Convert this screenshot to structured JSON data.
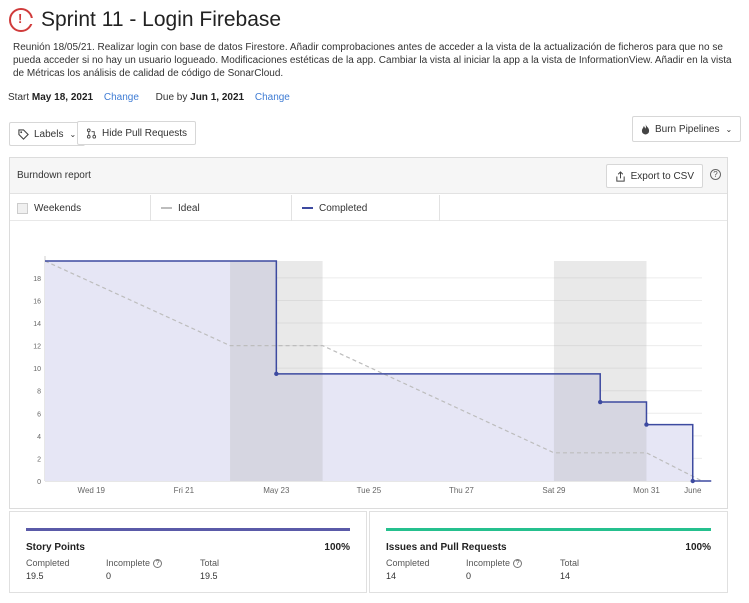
{
  "title": "Sprint 11 - Login Firebase",
  "description": "Reunión 18/05/21. Realizar login con base de datos Firestore. Añadir comprobaciones antes de acceder a la vista de la actualización de ficheros para que no se pueda acceder si no hay un usuario logueado. Modificaciones estéticas de la app. Cambiar la vista al iniciar la app a la vista de InformationView. Añadir en la vista de Métricas los análisis de calidad de código de SonarCloud.",
  "dates": {
    "start_label": "Start",
    "start_value": "May 18, 2021",
    "due_label": "Due by",
    "due_value": "Jun 1, 2021",
    "change_label": "Change"
  },
  "toolbar": {
    "labels_button": "Labels",
    "hide_pr_button": "Hide Pull Requests",
    "burn_pipelines_button": "Burn Pipelines"
  },
  "report": {
    "title": "Burndown report",
    "export_button": "Export to CSV",
    "legend": {
      "weekends": "Weekends",
      "ideal": "Ideal",
      "completed": "Completed"
    }
  },
  "colors": {
    "accent": "#3d4aa0",
    "ideal": "#bdbdbd",
    "weekend": "#e8e8e8",
    "completed_fill": "#e6e6f5",
    "danger": "#d03b3b",
    "issues_bar": "#25c08e",
    "story_bar": "#5a5aa8",
    "link": "#3f7cd4"
  },
  "chart_data": {
    "type": "line",
    "x_ticks": [
      "Wed 19",
      "Fri 21",
      "May 23",
      "Tue 25",
      "Thu 27",
      "Sat 29",
      "Mon 31",
      "June"
    ],
    "y_ticks": [
      0,
      2,
      4,
      6,
      8,
      10,
      12,
      14,
      16,
      18
    ],
    "ylim": [
      0,
      19.5
    ],
    "xlim": [
      0,
      14.2
    ],
    "weekends": [
      [
        4,
        6
      ],
      [
        11,
        13
      ]
    ],
    "series": [
      {
        "name": "Ideal",
        "style": "dashed",
        "points": [
          [
            0,
            19.5
          ],
          [
            4,
            12
          ],
          [
            6,
            12
          ],
          [
            11,
            2.5
          ],
          [
            13,
            2.5
          ],
          [
            14.2,
            0
          ]
        ]
      },
      {
        "name": "Completed",
        "style": "step",
        "points": [
          [
            0,
            19.5
          ],
          [
            5,
            19.5
          ],
          [
            5,
            9.5
          ],
          [
            12,
            9.5
          ],
          [
            12,
            7
          ],
          [
            13,
            7
          ],
          [
            13,
            5
          ],
          [
            14,
            5
          ],
          [
            14,
            0
          ],
          [
            14.4,
            0
          ]
        ],
        "markers": [
          [
            5,
            9.5
          ],
          [
            12,
            7
          ],
          [
            13,
            5
          ],
          [
            14,
            0
          ]
        ]
      }
    ]
  },
  "cards": [
    {
      "name": "Story Points",
      "percent": "100%",
      "completed_label": "Completed",
      "completed_value": "19.5",
      "incomplete_label": "Incomplete",
      "incomplete_value": "0",
      "total_label": "Total",
      "total_value": "19.5"
    },
    {
      "name": "Issues and Pull Requests",
      "percent": "100%",
      "completed_label": "Completed",
      "completed_value": "14",
      "incomplete_label": "Incomplete",
      "incomplete_value": "0",
      "total_label": "Total",
      "total_value": "14"
    }
  ]
}
